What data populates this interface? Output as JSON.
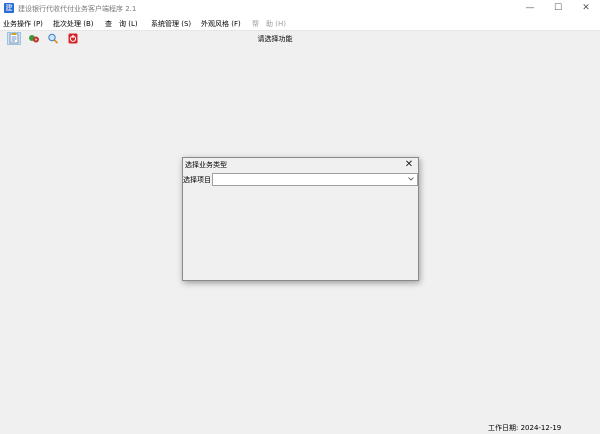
{
  "window": {
    "title": "建设银行代收代付业务客户端程序 2.1",
    "minimize": "—",
    "maximize": "☐",
    "close": "✕"
  },
  "menu": [
    {
      "label": "业务操作 (P)",
      "enabled": true
    },
    {
      "label": "批次处理 (B)",
      "enabled": true
    },
    {
      "label": "查　询 (L)",
      "enabled": true
    },
    {
      "label": "系统管理 (S)",
      "enabled": true
    },
    {
      "label": "外观风格 (F)",
      "enabled": true
    },
    {
      "label": "帮　助 (H)",
      "enabled": false
    }
  ],
  "toolbar": {
    "icons": [
      "document-icon",
      "settings-icon",
      "search-icon",
      "exit-icon"
    ]
  },
  "main": {
    "prompt": "请选择功能"
  },
  "dialog": {
    "title": "选择业务类型",
    "close": "✕",
    "label": "选择项目",
    "selected": ""
  },
  "status": {
    "work_date": "工作日期:  2024-12-19"
  },
  "colors": {
    "app_icon": "#2b6cd4",
    "background": "#f0f0f0",
    "active_button": "#cfe4f7"
  }
}
